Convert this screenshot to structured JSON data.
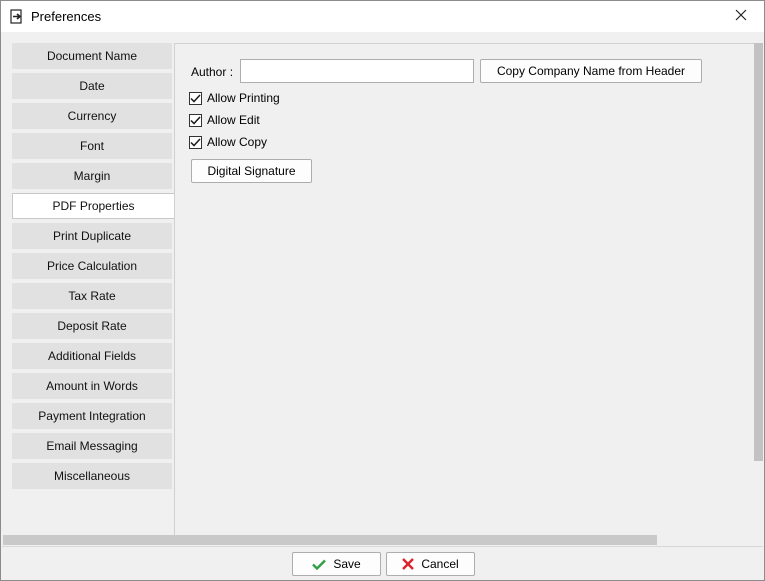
{
  "window": {
    "title": "Preferences",
    "icons": {
      "app": "export-document-icon",
      "close": "close-icon"
    }
  },
  "sidebar": {
    "items": [
      {
        "label": "Document Name"
      },
      {
        "label": "Date"
      },
      {
        "label": "Currency"
      },
      {
        "label": "Font"
      },
      {
        "label": "Margin"
      },
      {
        "label": "PDF Properties",
        "selected": true
      },
      {
        "label": "Print Duplicate"
      },
      {
        "label": "Price Calculation"
      },
      {
        "label": "Tax Rate"
      },
      {
        "label": "Deposit Rate"
      },
      {
        "label": "Additional Fields"
      },
      {
        "label": "Amount in Words"
      },
      {
        "label": "Payment Integration"
      },
      {
        "label": "Email Messaging"
      },
      {
        "label": "Miscellaneous"
      }
    ]
  },
  "pdf_properties": {
    "author_label": "Author :",
    "author_value": "",
    "author_placeholder": "",
    "copy_button": "Copy Company Name from Header",
    "checks": [
      {
        "label": "Allow Printing",
        "checked": true
      },
      {
        "label": "Allow Edit",
        "checked": true
      },
      {
        "label": "Allow Copy",
        "checked": true
      }
    ],
    "signature_button": "Digital Signature"
  },
  "footer": {
    "save_label": "Save",
    "cancel_label": "Cancel",
    "icons": {
      "save": "checkmark-icon",
      "cancel": "x-icon"
    }
  },
  "colors": {
    "accent": "#0078d7",
    "save_green": "#2ea043",
    "cancel_red": "#d9262c",
    "nav_bg": "#e1e1e1",
    "nav_selected_bg": "#ffffff"
  }
}
